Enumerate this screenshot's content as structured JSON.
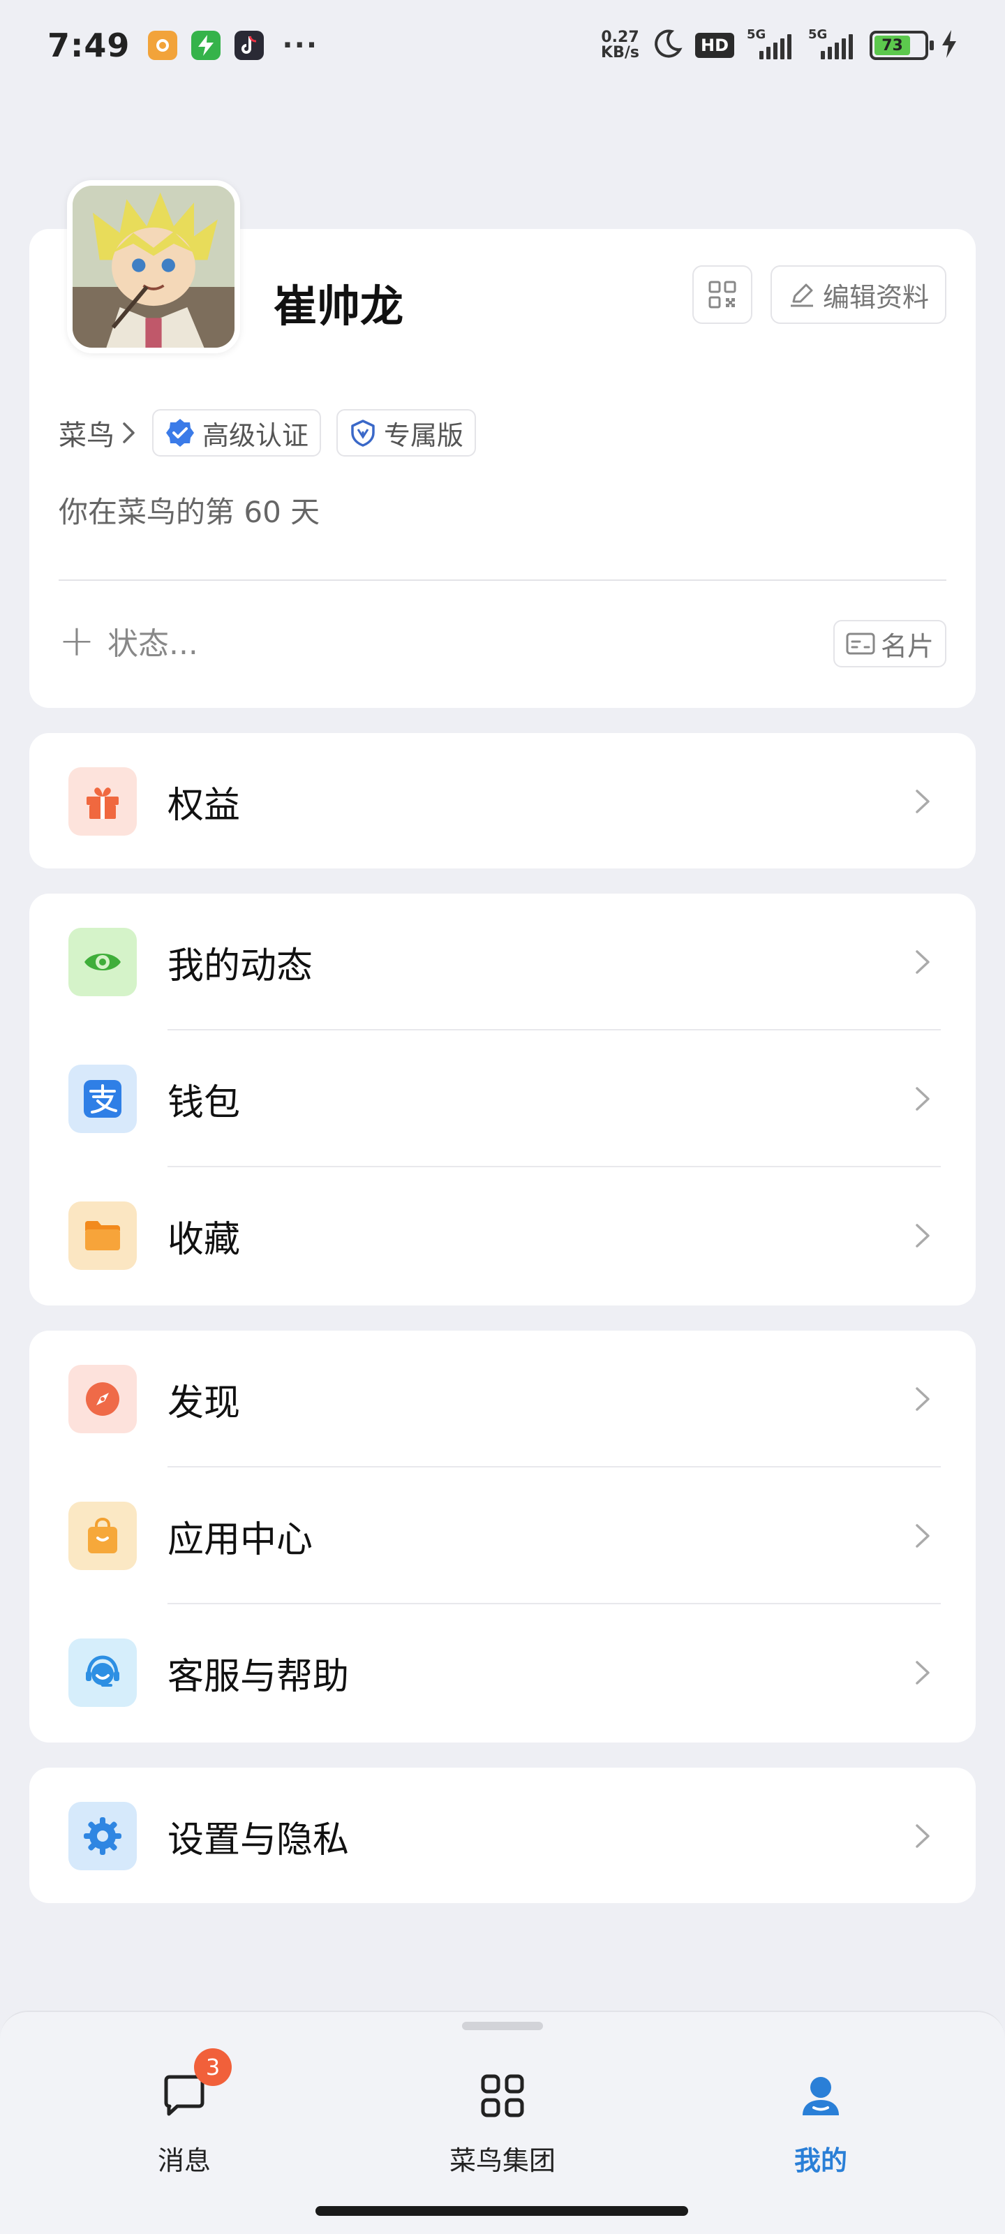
{
  "status_bar": {
    "time": "7:49",
    "speed_value": "0.27",
    "speed_unit": "KB/s",
    "hd_label": "HD",
    "sim1_label": "5G",
    "sim2_label": "5G",
    "battery_level": "73"
  },
  "profile": {
    "username": "崔帅龙",
    "edit_label": "编辑资料",
    "org_label": "菜鸟",
    "verified_label": "高级认证",
    "edition_label": "专属版",
    "days_text": "你在菜鸟的第 60 天",
    "status_placeholder": "状态...",
    "card_label": "名片"
  },
  "menu": {
    "rights": "权益",
    "moments": "我的动态",
    "wallet": "钱包",
    "favorites": "收藏",
    "discover": "发现",
    "app_center": "应用中心",
    "support": "客服与帮助",
    "settings": "设置与隐私"
  },
  "bottom_nav": {
    "messages_label": "消息",
    "messages_badge": "3",
    "group_label": "菜鸟集团",
    "me_label": "我的"
  },
  "colors": {
    "accent_blue": "#2a7fd7",
    "badge_red": "#f1603a",
    "background": "#eeeff4"
  }
}
